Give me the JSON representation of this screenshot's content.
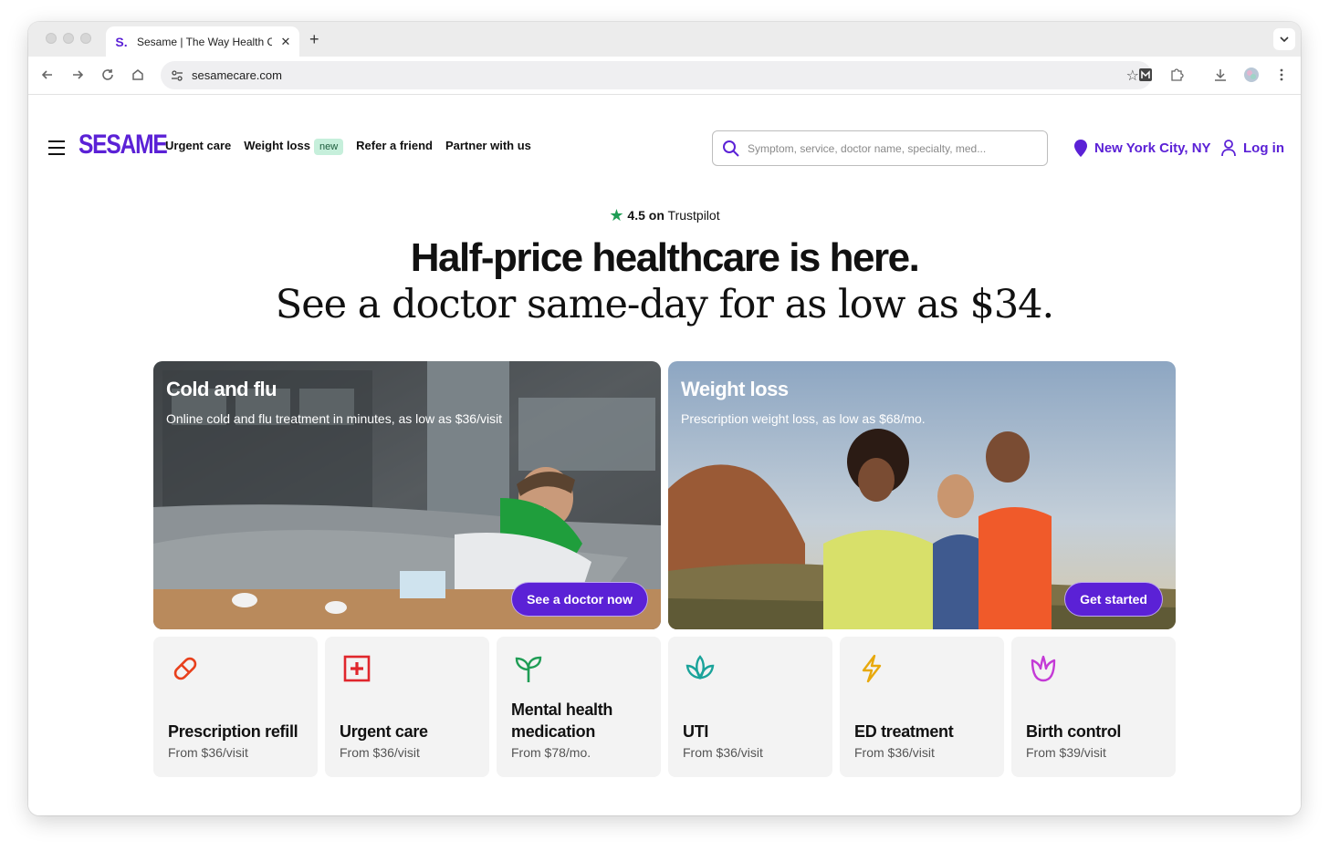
{
  "browser": {
    "tab_title": "Sesame | The Way Health Car",
    "tab_favicon": "S.",
    "close_glyph": "✕",
    "new_tab_glyph": "+",
    "tab_menu_glyph": "⌄",
    "url": "sesamecare.com"
  },
  "header": {
    "logo": "SESAME",
    "nav": {
      "urgent_care": "Urgent care",
      "weight_loss": "Weight loss",
      "weight_loss_badge": "new",
      "refer": "Refer a friend",
      "partner": "Partner with us"
    },
    "search_placeholder": "Symptom, service, doctor name, specialty, med...",
    "location": "New York City, NY",
    "login": "Log in"
  },
  "hero": {
    "rating": "4.5 on",
    "rating_source": "Trustpilot",
    "headline": "Half-price healthcare is here.",
    "subheadline": "See a doctor same-day for as low as $34."
  },
  "features": [
    {
      "title": "Cold and flu",
      "description": "Online cold and flu treatment in minutes, as low as $36/visit",
      "cta": "See a doctor now"
    },
    {
      "title": "Weight loss",
      "description": "Prescription weight loss, as low as $68/mo.",
      "cta": "Get started"
    }
  ],
  "services": [
    {
      "name": "Prescription refill",
      "price": "From $36/visit",
      "icon": "pill-icon",
      "color": "#e8401c"
    },
    {
      "name": "Urgent care",
      "price": "From $36/visit",
      "icon": "medical-cross-icon",
      "color": "#e0262c"
    },
    {
      "name": "Mental health medication",
      "price": "From $78/mo.",
      "icon": "sprout-icon",
      "color": "#1f9d55"
    },
    {
      "name": "UTI",
      "price": "From $36/visit",
      "icon": "lotus-icon",
      "color": "#1aa39a"
    },
    {
      "name": "ED treatment",
      "price": "From $36/visit",
      "icon": "lightning-icon",
      "color": "#e8a90c"
    },
    {
      "name": "Birth control",
      "price": "From $39/visit",
      "icon": "tulip-icon",
      "color": "#c43ad6"
    }
  ],
  "colors": {
    "brand": "#5b21d6",
    "tile_bg": "#f3f3f3"
  }
}
